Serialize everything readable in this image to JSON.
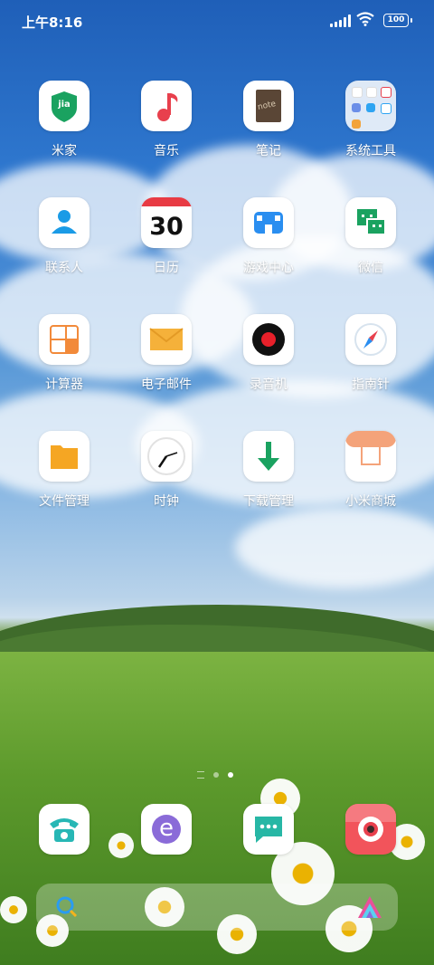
{
  "status": {
    "time": "上午8:16",
    "battery": "100"
  },
  "apps": [
    {
      "label": "米家",
      "icon": "mijia-icon",
      "text": "jia"
    },
    {
      "label": "音乐",
      "icon": "music-icon"
    },
    {
      "label": "笔记",
      "icon": "notes-icon",
      "text": "note"
    },
    {
      "label": "系统工具",
      "icon": "system-tools-folder-icon"
    },
    {
      "label": "联系人",
      "icon": "contacts-icon"
    },
    {
      "label": "日历",
      "icon": "calendar-icon",
      "text": "30"
    },
    {
      "label": "游戏中心",
      "icon": "game-center-icon"
    },
    {
      "label": "微信",
      "icon": "wechat-icon"
    },
    {
      "label": "计算器",
      "icon": "calculator-icon",
      "text": "+ − × ="
    },
    {
      "label": "电子邮件",
      "icon": "email-icon"
    },
    {
      "label": "录音机",
      "icon": "recorder-icon"
    },
    {
      "label": "指南针",
      "icon": "compass-icon"
    },
    {
      "label": "文件管理",
      "icon": "file-manager-icon"
    },
    {
      "label": "时钟",
      "icon": "clock-icon"
    },
    {
      "label": "下载管理",
      "icon": "download-manager-icon"
    },
    {
      "label": "小米商城",
      "icon": "mi-store-icon"
    }
  ],
  "dock": [
    {
      "name": "phone",
      "icon": "phone-icon"
    },
    {
      "name": "browser",
      "icon": "browser-icon",
      "text": "e"
    },
    {
      "name": "messages",
      "icon": "messages-icon"
    },
    {
      "name": "camera",
      "icon": "camera-icon"
    }
  ],
  "colors": {
    "accent_green": "#1aa260",
    "accent_red": "#e8404d",
    "calendar_red": "#e83b44"
  }
}
